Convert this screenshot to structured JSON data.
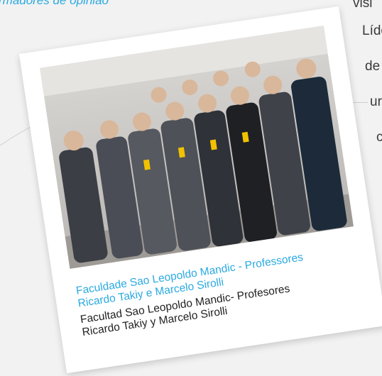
{
  "top_caption": "rmadores de opinião",
  "side_text": [
    "visi",
    "Lído",
    "de",
    "ur",
    "c"
  ],
  "card": {
    "caption_pt": [
      "Faculdade Sao Leopoldo Mandic - Professores",
      "Ricardo Takiy e Marcelo Sirolli"
    ],
    "caption_es": [
      "Facultad Sao Leopoldo Mandic- Profesores",
      "Ricardo Takiy y Marcelo Sirolli"
    ]
  },
  "colors": {
    "accent_blue": "#2aa9e0",
    "caption_dark": "#1f1f1f",
    "background": "#f2f2f2",
    "card": "#ffffff"
  }
}
